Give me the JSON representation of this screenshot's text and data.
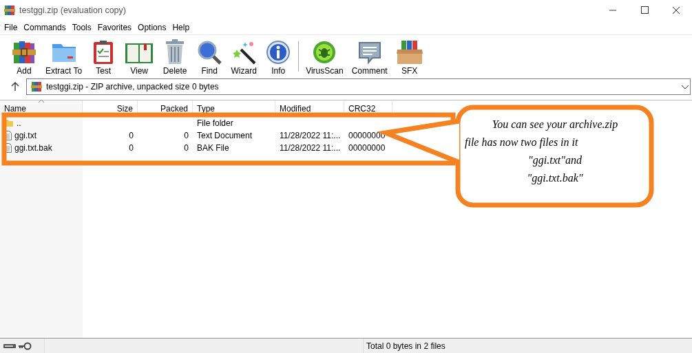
{
  "window": {
    "title": "testggi.zip (evaluation copy)"
  },
  "menu": [
    "File",
    "Commands",
    "Tools",
    "Favorites",
    "Options",
    "Help"
  ],
  "toolbar": [
    {
      "label": "Add"
    },
    {
      "label": "Extract To"
    },
    {
      "label": "Test"
    },
    {
      "label": "View"
    },
    {
      "label": "Delete"
    },
    {
      "label": "Find"
    },
    {
      "label": "Wizard"
    },
    {
      "label": "Info"
    },
    {
      "label": "VirusScan"
    },
    {
      "label": "Comment"
    },
    {
      "label": "SFX"
    }
  ],
  "address": {
    "path": "testggi.zip - ZIP archive, unpacked size 0 bytes"
  },
  "table": {
    "columns": [
      "Name",
      "Size",
      "Packed",
      "Type",
      "Modified",
      "CRC32"
    ],
    "rows": [
      {
        "kind": "folder",
        "cells": [
          "..",
          "",
          "",
          "File folder",
          "",
          ""
        ]
      },
      {
        "kind": "file",
        "cells": [
          "ggi.txt",
          "0",
          "0",
          "Text Document",
          "11/28/2022 11:...",
          "00000000"
        ]
      },
      {
        "kind": "file",
        "cells": [
          "ggi.txt.bak",
          "0",
          "0",
          "BAK File",
          "11/28/2022 11:...",
          "00000000"
        ]
      }
    ]
  },
  "callout": {
    "lines": [
      "You can see your archive.zip",
      "file has now two files in it",
      "\"ggi.txt\"and",
      "\"ggi.txt.bak\""
    ]
  },
  "status_bar": {
    "text": "Total 0 bytes in 2 files"
  }
}
